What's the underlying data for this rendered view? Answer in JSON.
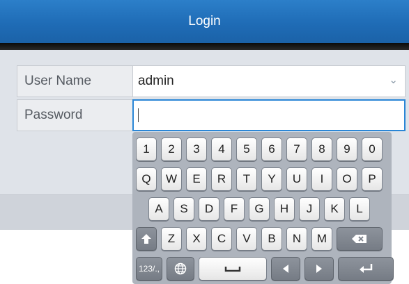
{
  "header": {
    "title": "Login"
  },
  "form": {
    "username": {
      "label": "User Name",
      "value": "admin"
    },
    "password": {
      "label": "Password",
      "value": ""
    }
  },
  "keyboard": {
    "row1": [
      "1",
      "2",
      "3",
      "4",
      "5",
      "6",
      "7",
      "8",
      "9",
      "0"
    ],
    "row2": [
      "Q",
      "W",
      "E",
      "R",
      "T",
      "Y",
      "U",
      "I",
      "O",
      "P"
    ],
    "row3": [
      "A",
      "S",
      "D",
      "F",
      "G",
      "H",
      "J",
      "K",
      "L"
    ],
    "row4": [
      "Z",
      "X",
      "C",
      "V",
      "B",
      "N",
      "M"
    ],
    "mode_key_label": "123/.,",
    "icons": {
      "shift": "shift-icon",
      "backspace": "backspace-icon",
      "globe": "globe-icon",
      "space": "space-icon",
      "left": "arrow-left-icon",
      "right": "arrow-right-icon",
      "enter": "enter-icon"
    }
  }
}
